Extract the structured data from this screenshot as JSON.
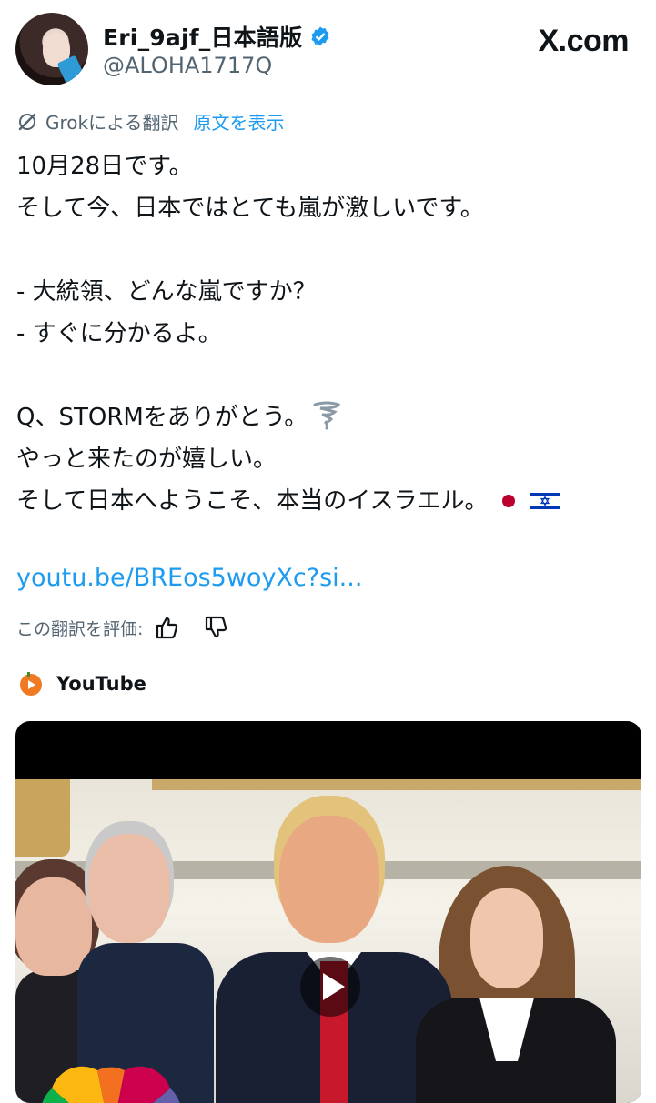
{
  "header": {
    "display_name": "Eri_9ajf_日本語版",
    "handle": "@ALOHA1717Q",
    "site": "X.com"
  },
  "translation": {
    "grok_label": "Grokによる翻訳",
    "show_original": "原文を表示"
  },
  "post": {
    "lines": [
      "10月28日です。",
      "そして今、日本ではとても嵐が激しいです。",
      "",
      "- 大統領、どんな嵐ですか？",
      "- すぐに分かるよ。",
      "",
      "Q、STORMをありがとう。",
      "やっと来たのが嬉しい。",
      "そして日本へようこそ、本当のイスラエル。"
    ],
    "link": "youtu.be/BREos5woyXc?si..."
  },
  "rating": {
    "label": "この翻訳を評価:"
  },
  "card": {
    "source": "YouTube"
  },
  "colors": {
    "accent": "#1d9bf0",
    "text": "#0f1419",
    "secondary": "#536471"
  },
  "icons": [
    "verified-badge-icon",
    "grok-icon",
    "thumbs-up-icon",
    "thumbs-down-icon",
    "youtube-icon",
    "play-icon",
    "tornado-emoji",
    "japan-flag-emoji",
    "israel-flag-emoji"
  ]
}
